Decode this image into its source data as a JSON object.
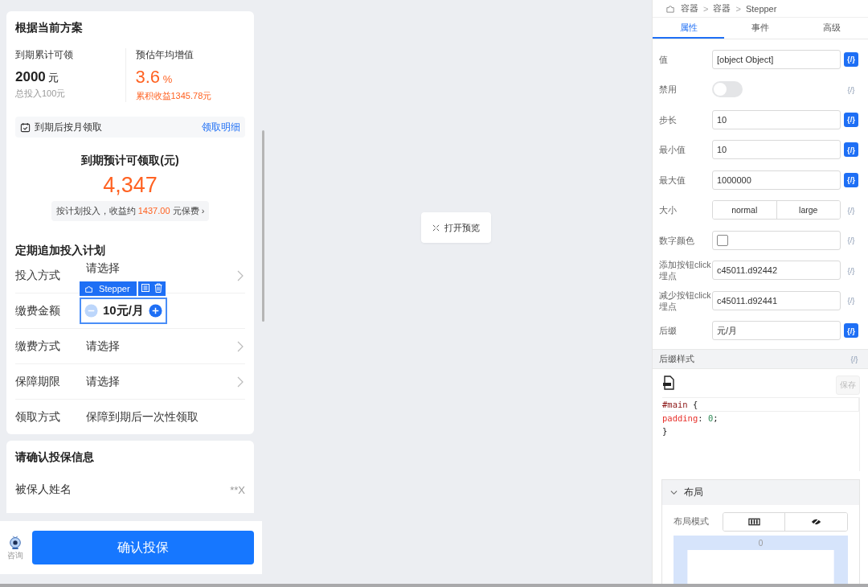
{
  "plan_card": {
    "title": "根据当前方案",
    "stats": [
      {
        "label": "到期累计可领",
        "value": "2000",
        "unit": "元",
        "note": "总投入100元",
        "kind": "plain"
      },
      {
        "label": "预估年均增值",
        "value": "3.6",
        "unit": "%",
        "note": "累积收益1345.78元",
        "kind": "accent"
      }
    ],
    "payout_bar": {
      "label": "到期后按月领取",
      "link": "领取明细"
    },
    "estimate": {
      "title": "到期预计可领取(元)",
      "amount": "4,347",
      "tip_prefix": "按计划投入，收益约",
      "tip_amount": "1437.00",
      "tip_suffix": "元保费",
      "tip_chevron": "›"
    }
  },
  "plan_form": {
    "title": "定期追加投入计划",
    "rows": [
      {
        "label": "投入方式",
        "kind": "select",
        "value": "请选择"
      },
      {
        "label": "缴费金额",
        "kind": "stepper",
        "value": "10元/月",
        "minus_disabled": true
      },
      {
        "label": "缴费方式",
        "kind": "select",
        "value": "请选择"
      },
      {
        "label": "保障期限",
        "kind": "select",
        "value": "请选择"
      },
      {
        "label": "领取方式",
        "kind": "text",
        "value": "保障到期后一次性领取"
      }
    ]
  },
  "selection_toolbar": {
    "label": "Stepper"
  },
  "confirm_card": {
    "title": "请确认投保信息",
    "rows": [
      {
        "label": "被保人姓名",
        "value": "**X"
      }
    ]
  },
  "footer": {
    "consult_label": "咨询",
    "button": "确认投保"
  },
  "preview_button": "打开预览",
  "inspector": {
    "breadcrumb": [
      "容器",
      "容器",
      "Stepper"
    ],
    "breadcrumb_separators": [
      ">",
      ">"
    ],
    "tabs": [
      {
        "label": "属性",
        "selected": true
      },
      {
        "label": "事件",
        "selected": false
      },
      {
        "label": "高级",
        "selected": false
      }
    ],
    "props": [
      {
        "label": "值",
        "kind": "text",
        "value": "[object Object]",
        "bind": "{/}",
        "bound": true
      },
      {
        "label": "禁用",
        "kind": "switch",
        "on": false,
        "bind": "{/}",
        "bound": false
      },
      {
        "label": "步长",
        "kind": "text",
        "value": "10",
        "bind": "{/}",
        "bound": true
      },
      {
        "label": "最小值",
        "kind": "text",
        "value": "10",
        "bind": "{/}",
        "bound": true
      },
      {
        "label": "最大值",
        "kind": "text",
        "value": "1000000",
        "bind": "{/}",
        "bound": true
      },
      {
        "label": "大小",
        "kind": "segmented",
        "options": [
          "normal",
          "large"
        ],
        "bind": "{/}",
        "bound": false
      },
      {
        "label": "数字颜色",
        "kind": "color",
        "bind": "{/}",
        "bound": false
      },
      {
        "label": "添加按钮click埋点",
        "kind": "text",
        "value": "c45011.d92442",
        "bind": "{/}",
        "bound": false
      },
      {
        "label": "减少按钮click埋点",
        "kind": "text",
        "value": "c45011.d92441",
        "bind": "{/}",
        "bound": false
      },
      {
        "label": "后缀",
        "kind": "text",
        "value": "元/月",
        "bind": "{/}",
        "bound": true
      }
    ],
    "style_section": {
      "title": "后缀样式",
      "bind": "{/}",
      "save": "保存",
      "code": [
        [
          {
            "text": "#main",
            "kind": "selector"
          },
          {
            "text": " {",
            "kind": "punct"
          }
        ],
        [
          {
            "text": "  padding",
            "kind": "property"
          },
          {
            "text": ": ",
            "kind": "punct"
          },
          {
            "text": "0",
            "kind": "number"
          },
          {
            "text": ";",
            "kind": "punct"
          }
        ],
        [
          {
            "text": "}",
            "kind": "punct"
          }
        ]
      ]
    },
    "layout_section": {
      "title": "布局",
      "expanded": true,
      "mode_label": "布局模式",
      "box_value": "0"
    }
  }
}
